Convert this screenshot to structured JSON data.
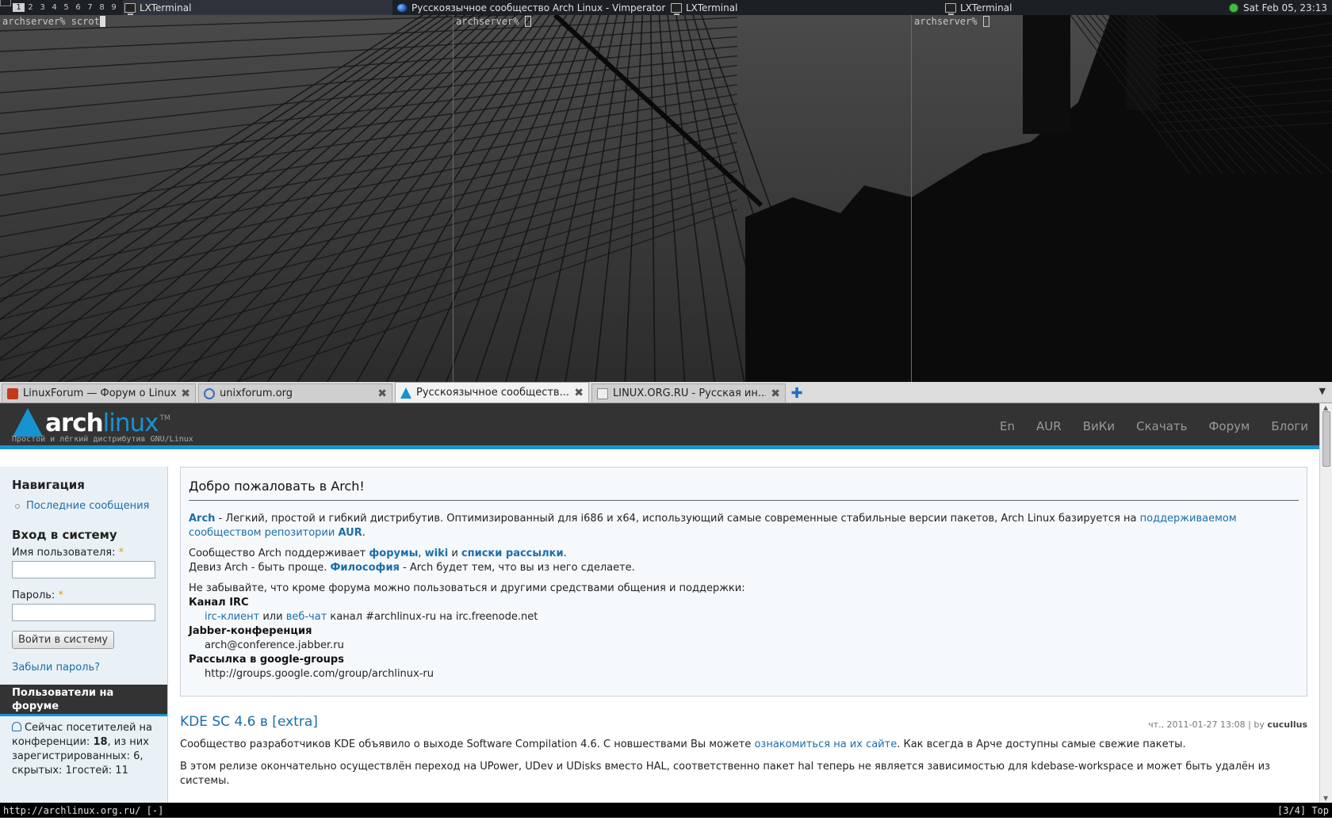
{
  "panel": {
    "workspaces": [
      "1",
      "2",
      "3",
      "4",
      "5",
      "6",
      "7",
      "8",
      "9"
    ],
    "active_workspace": "1",
    "tasks": [
      {
        "label": "LXTerminal",
        "icon": "terminal-icon"
      },
      {
        "label": "Русскоязычное сообщество Arch Linux - Vimperator",
        "icon": "globe-icon"
      },
      {
        "label": "LXTerminal",
        "icon": "terminal-icon"
      },
      {
        "label": "LXTerminal",
        "icon": "terminal-icon"
      }
    ],
    "clock": "Sat Feb 05, 23:13"
  },
  "terminals": [
    {
      "prompt": "archserver% scrot"
    },
    {
      "prompt": "archserver%"
    },
    {
      "prompt": "archserver%"
    }
  ],
  "browser": {
    "tabs": [
      {
        "label": "LinuxForum — Форум о Linux",
        "close": "✖"
      },
      {
        "label": "unixforum.org",
        "close": "✖"
      },
      {
        "label": "Русскоязычное сообществ...",
        "close": "✖"
      },
      {
        "label": "LINUX.ORG.RU - Русская ин...",
        "close": "✖"
      }
    ],
    "newtab": "✚",
    "tabmenu": "▼",
    "status_url": "http://archlinux.org.ru/ [-]",
    "status_pos": "[3/4] Top"
  },
  "site": {
    "logo_arch": "arch",
    "logo_linux": "linux",
    "logo_tm": "TM",
    "tagline": "Простой и лёгкий дистрибутив GNU/Linux",
    "nav": [
      "En",
      "AUR",
      "ВиКи",
      "Скачать",
      "Форум",
      "Блоги"
    ]
  },
  "sidebar": {
    "nav_title": "Навигация",
    "nav_link": "Последние сообщения",
    "login_title": "Вход в систему",
    "username_label": "Имя пользователя:",
    "password_label": "Пароль:",
    "required": "*",
    "login_button": "Войти в систему",
    "forgot": "Забыли пароль?",
    "users_title": "Пользователи на форуме",
    "users_text_1": "Сейчас посетителей на конференции:",
    "users_count": "18",
    "users_text_2": ", из них зарегистрированных: 6, скрытых: 1гостей: 11"
  },
  "welcome": {
    "title": "Добро пожаловать в Arch!",
    "p1_link_arch": "Arch",
    "p1_text": " - Легкий, простой и гибкий дистрибутив. Оптимизированный для i686 и x64, использующий самые современные стабильные версии пакетов, Arch Linux базируется на ",
    "p1_link_supported": "поддерживаемом сообществом репозитории",
    "p1_link_aur": "AUR",
    "p1_end": ".",
    "p2_text": "Сообщество Arch поддерживает ",
    "p2_link_forums": "форумы",
    "p2_comma": ", ",
    "p2_link_wiki": "wiki",
    "p2_and": " и ",
    "p2_link_lists": "списки рассылки",
    "p2_end": ".",
    "p3_text": "Девиз Arch - быть проще. ",
    "p3_link": "Философия",
    "p3_end": " - Arch будет тем, что вы из него сделаете.",
    "p4_text": "Не забывайте, что кроме форума можно пользоваться и другими средствами общения и поддержки:",
    "irc_title": "Канал IRC",
    "irc_link_client": "irc-клиент",
    "irc_or": " или ",
    "irc_link_web": "веб-чат",
    "irc_rest": " канал #archlinux-ru на irc.freenode.net",
    "jabber_title": "Jabber-конференция",
    "jabber_addr": "arch@conference.jabber.ru",
    "groups_title": "Рассылка в google-groups",
    "groups_url": "http://groups.google.com/group/archlinux-ru"
  },
  "news": {
    "title": "KDE SC 4.6 в [extra]",
    "meta": "чт., 2011-01-27 13:08 | by ",
    "author": "cucullus",
    "p1_text": "Сообщество разработчиков KDE объявило о выходе Software Compilation 4.6. С новшествами Вы можете ",
    "p1_link": "ознакомиться на их сайте",
    "p1_end": ". Как всегда в Арче доступны самые свежие пакеты.",
    "p2_text": "В этом релизе окончательно осуществлён переход на UPower, UDev и UDisks вместо HAL, соответственно пакет hal теперь не является зависимостью для kdebase-workspace и может быть удалён из системы."
  }
}
